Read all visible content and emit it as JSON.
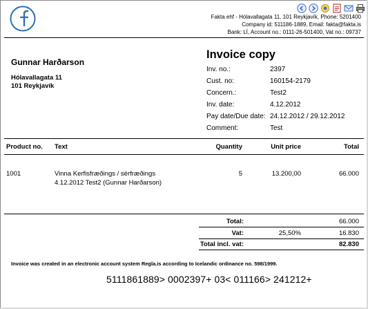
{
  "toolbar": {
    "icons": [
      "back-arrow-icon",
      "forward-arrow-icon",
      "circle-icon",
      "pdf-icon",
      "email-icon",
      "print-icon",
      "close-icon"
    ]
  },
  "company": {
    "line1": "Fakta ehf - Hólavallagata 11, 101 Reykjavík,  Phone:  5201400",
    "line2": "Company id:  511186-1889,  Email:  fakta@fakta.is",
    "line3": "Bank:  LÍ, Account no.:  0111-26-501400, Vat no.:  09737"
  },
  "customer": {
    "name": "Gunnar Harðarson",
    "address_line1": "Hólavallagata 11",
    "address_line2": "101 Reykjavík"
  },
  "invoice": {
    "title": "Invoice copy",
    "fields": [
      {
        "label": "Inv. no.:",
        "value": "2397"
      },
      {
        "label": "Cust. no:",
        "value": "160154-2179"
      },
      {
        "label": "Concern.:",
        "value": "Test2"
      },
      {
        "label": "Inv. date:",
        "value": "4.12.2012"
      },
      {
        "label": "Pay date/Due date:",
        "value": "24.12.2012 / 29.12.2012"
      },
      {
        "label": "Comment:",
        "value": "Test"
      }
    ]
  },
  "table": {
    "headers": {
      "product_no": "Product no.",
      "text": "Text",
      "quantity": "Quantity",
      "unit_price": "Unit price",
      "total": "Total"
    },
    "rows": [
      {
        "product_no": "1001",
        "text_line1": "Vinna Kerfisfræðings / sérfræðings",
        "text_line2": "4.12.2012 Test2 (Gunnar Harðarson)",
        "quantity": "5",
        "unit_price": "13.200,00",
        "total": "66.000"
      }
    ]
  },
  "summary": {
    "total_label": "Total:",
    "total_value": "66.000",
    "vat_label": "Vat:",
    "vat_rate": "25,50%",
    "vat_value": "16.830",
    "grand_label": "Total incl. vat:",
    "grand_value": "82.830"
  },
  "notice": "Invoice was created in an electronic account system Regla.is according to Icelandic ordinance no. 598/1999.",
  "ocr_line": "5111861889> 0002397+ 03< 011166> 241212+",
  "colors": {
    "logo_blue": "#2a6fb5",
    "nav_blue": "#3b6fd0",
    "close_red": "#d02020"
  }
}
